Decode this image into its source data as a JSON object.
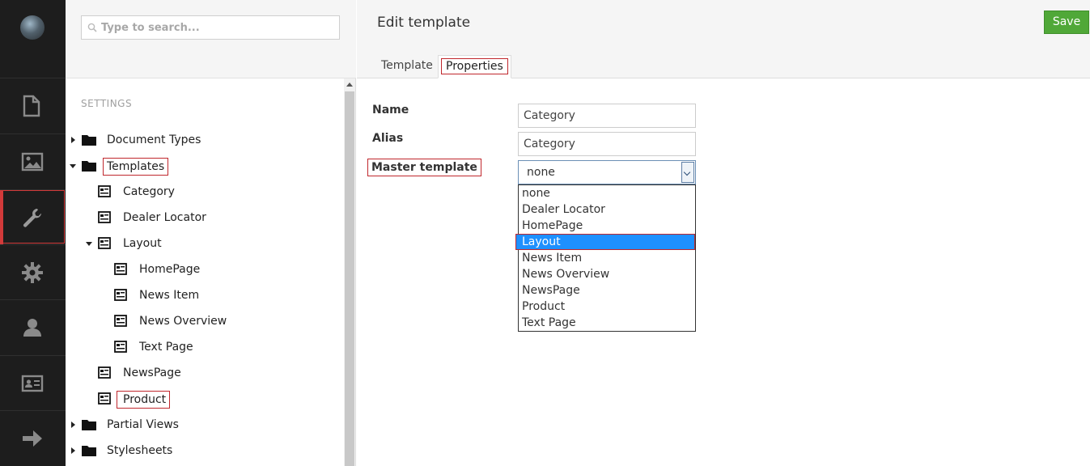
{
  "search": {
    "placeholder": "Type to search..."
  },
  "tree": {
    "section_label": "SETTINGS",
    "items": [
      {
        "label": "Document Types"
      },
      {
        "label": "Templates"
      },
      {
        "label": "Category"
      },
      {
        "label": "Dealer Locator"
      },
      {
        "label": "Layout"
      },
      {
        "label": "HomePage"
      },
      {
        "label": "News Item"
      },
      {
        "label": "News Overview"
      },
      {
        "label": "Text Page"
      },
      {
        "label": "NewsPage"
      },
      {
        "label": "Product"
      },
      {
        "label": "Partial Views"
      },
      {
        "label": "Stylesheets"
      }
    ]
  },
  "header": {
    "title": "Edit template",
    "save_label": "Save",
    "tabs": [
      {
        "label": "Template"
      },
      {
        "label": "Properties"
      }
    ]
  },
  "form": {
    "name_label": "Name",
    "name_value": "Category",
    "alias_label": "Alias",
    "alias_value": "Category",
    "master_label": "Master template",
    "master_value": "none",
    "options": [
      "none",
      "Dealer Locator",
      "HomePage",
      "Layout",
      "News Item",
      "News Overview",
      "NewsPage",
      "Product",
      "Text Page"
    ]
  },
  "colors": {
    "sidebar_bg": "#1d1d1d",
    "save_green": "#50a838",
    "highlight_red": "#c0272d",
    "option_selected": "#1e90ff"
  }
}
